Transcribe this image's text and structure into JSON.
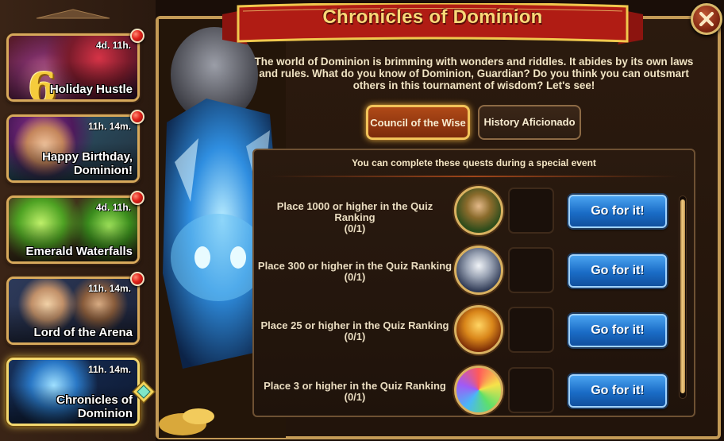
{
  "window": {
    "title": "Chronicles of Dominion",
    "intro": "The world of Dominion is brimming with wonders and riddles. It abides by its own laws and rules. What do you know of Dominion, Guardian? Do you think you can outsmart others in this tournament of wisdom? Let's see!"
  },
  "events": [
    {
      "title": "Holiday Hustle",
      "time": "4d. 11h.",
      "badge": "6",
      "icon": "gift-icon"
    },
    {
      "title": "Happy Birthday, Dominion!",
      "time": "11h. 14m.",
      "icon": "hero-portrait-icon"
    },
    {
      "title": "Emerald Waterfalls",
      "time": "4d. 11h.",
      "icon": "emerald-icon"
    },
    {
      "title": "Lord of the Arena",
      "time": "11h. 14m.",
      "icon": "heroes-portrait-icon"
    },
    {
      "title": "Chronicles of Dominion",
      "time": "11h. 14m.",
      "icon": "crystal-statue-icon"
    }
  ],
  "tabs": {
    "council": "Council of the Wise",
    "history": "History Aficionado",
    "active": "council"
  },
  "quests": {
    "header": "You can complete these quests during a special event",
    "button_label": "Go for it!",
    "items": [
      {
        "text": "Place 1000 or higher in the Quiz Ranking",
        "progress": "(0/1)",
        "tier": "bronze-statue-icon"
      },
      {
        "text": "Place 300 or higher in the Quiz Ranking",
        "progress": "(0/1)",
        "tier": "silver-statue-icon"
      },
      {
        "text": "Place 25 or higher in the Quiz Ranking",
        "progress": "(0/1)",
        "tier": "gold-statue-icon"
      },
      {
        "text": "Place 3 or higher in the Quiz Ranking",
        "progress": "(0/1)",
        "tier": "crystal-statue-icon"
      }
    ]
  },
  "colors": {
    "banner_red": "#b01c14",
    "title_gold": "#f9d878",
    "button_blue": "#1a6cc6",
    "frame_gold": "#c39a56"
  }
}
